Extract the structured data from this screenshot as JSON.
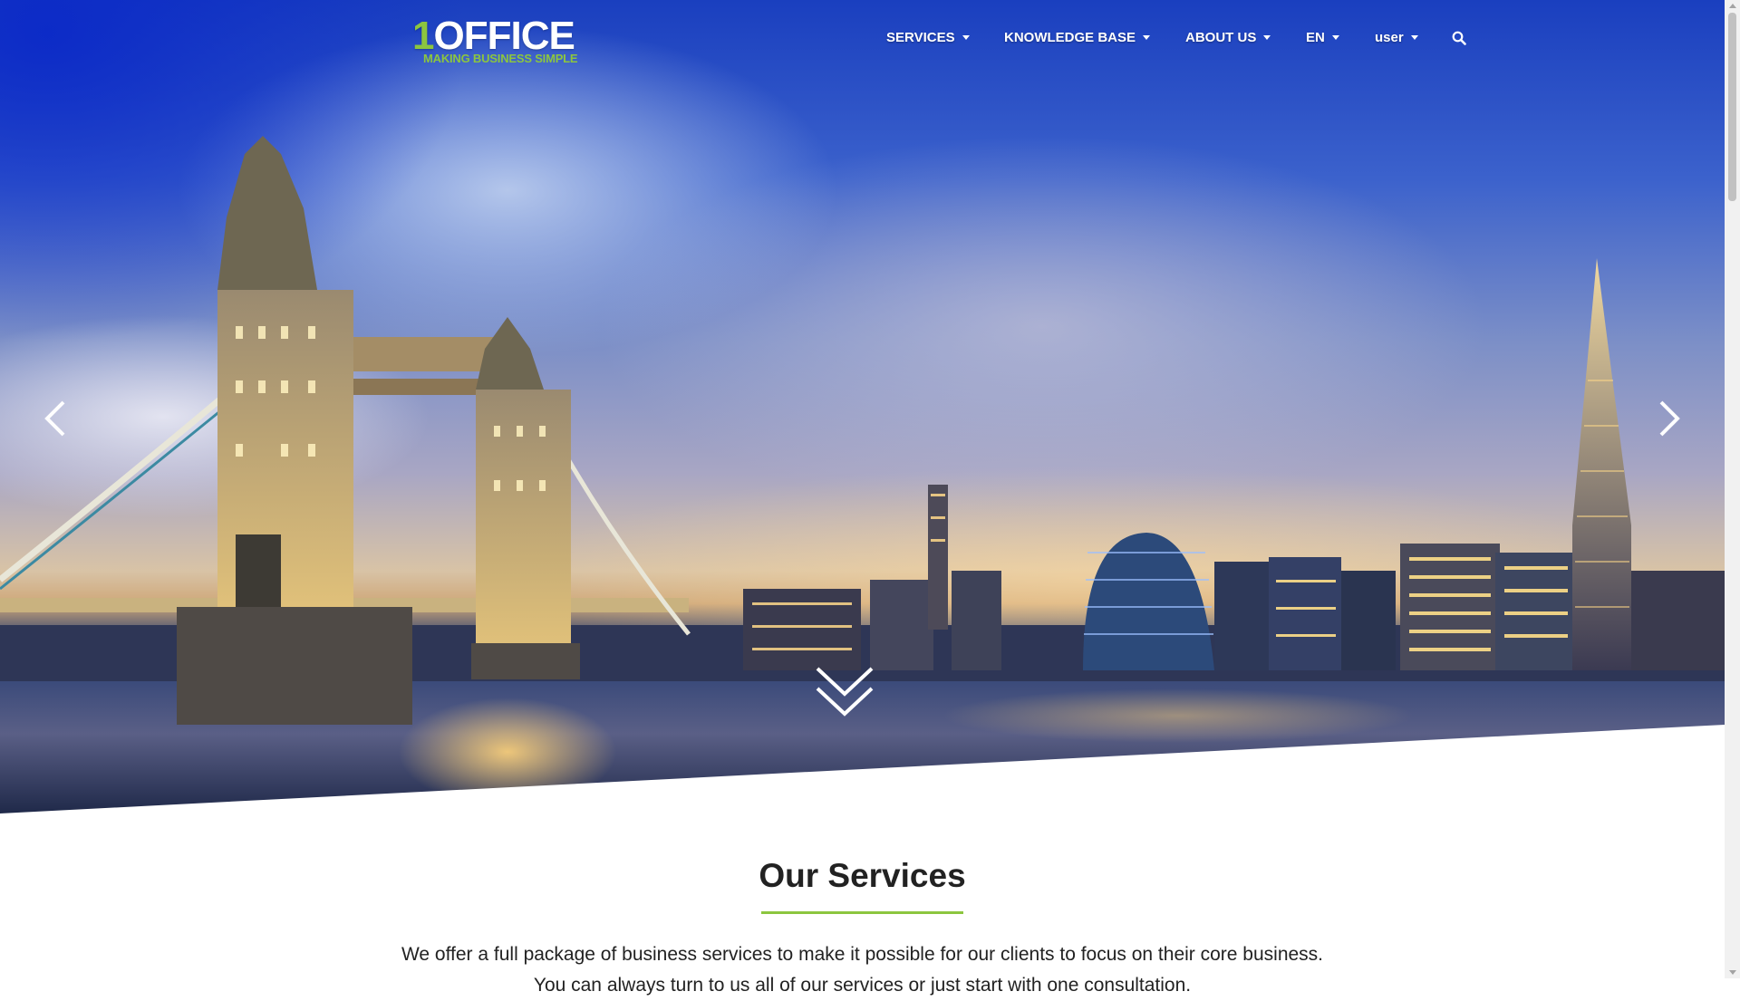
{
  "brand": {
    "logo_digit": "1",
    "logo_word": "OFFICE",
    "tagline": "MAKING BUSINESS SIMPLE",
    "accent_color": "#8cc63f"
  },
  "nav": {
    "items": [
      {
        "label": "SERVICES",
        "has_dropdown": true
      },
      {
        "label": "KNOWLEDGE BASE",
        "has_dropdown": true
      },
      {
        "label": "ABOUT US",
        "has_dropdown": true
      },
      {
        "label": "EN",
        "has_dropdown": true
      },
      {
        "label": "user",
        "has_dropdown": true
      }
    ],
    "search_icon": "search-icon"
  },
  "hero": {
    "prev_icon": "chevron-left-icon",
    "next_icon": "chevron-right-icon",
    "scroll_icon": "double-chevron-down-icon"
  },
  "services": {
    "title": "Our Services",
    "paragraph_line1": "We offer a full package of business services to make it possible for our clients to focus on their core business.",
    "paragraph_line2": "You can always turn to us all of our services or just start with one consultation."
  }
}
